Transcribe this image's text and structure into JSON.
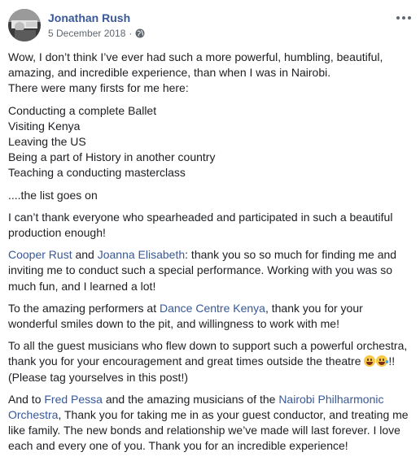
{
  "post": {
    "author": "Jonathan Rush",
    "date": "5 December 2018",
    "separator": "·",
    "privacy_icon": "globe-icon",
    "more_icon": "more-options-icon"
  },
  "content": {
    "p1": "Wow, I don’t think I’ve ever had such a more powerful, humbling, beautiful, amazing, and incredible experience, than when I was in Nairobi.",
    "p1b": "There were many firsts for me here:",
    "firsts": [
      "Conducting a complete Ballet",
      "Visiting Kenya",
      "Leaving the US",
      "Being a part of History in another country",
      "Teaching a conducting masterclass"
    ],
    "list_goes_on": "....the list goes on",
    "p_thanks": "I can’t thank everyone who spearheaded and participated in such a beautiful production enough!",
    "p_cooper": {
      "link1": "Cooper Rust",
      "and": " and ",
      "link2": "Joanna Elisabeth",
      "text": ": thank you so so much for finding me and inviting me to conduct such a special performance. Working with you was so much fun, and I learned a lot!"
    },
    "p_dance": {
      "before": "To the amazing performers at ",
      "link": "Dance Centre Kenya",
      "after": ", thank you for your wonderful smiles down to the pit, and willingness to work with me!"
    },
    "p_guests": {
      "before": "To all the guest musicians who flew down to support such a powerful orchestra, thank you for your encouragement and great times outside the theatre ",
      "emoji1": "grinning-face-icon",
      "emoji2": "tears-of-joy-icon",
      "after": "!! (Please tag yourselves in this post!)"
    },
    "p_fred": {
      "before": "And to ",
      "link1": "Fred Pessa",
      "middle": " and the amazing musicians of the ",
      "link2": "Nairobi Philharmonic Orchestra",
      "after": ", Thank you for taking me in as your guest conductor, and treating me like family. The new bonds and relationship we’ve made will last forever. I love each and every one of you. Thank you for an incredible experience!"
    }
  },
  "colors": {
    "link": "#385898",
    "text": "#1c1e21",
    "meta": "#606770"
  }
}
